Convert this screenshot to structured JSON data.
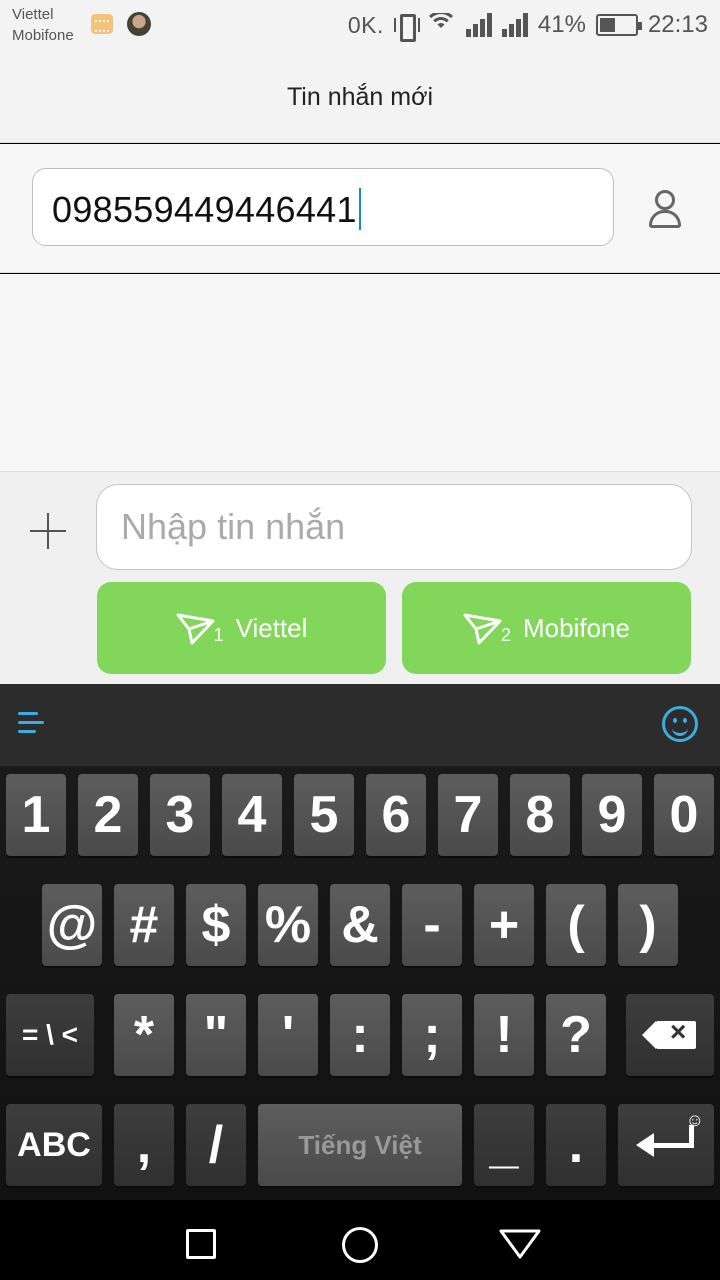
{
  "status_bar": {
    "carrier_1": "Viettel",
    "carrier_2": "Mobifone",
    "speed": "0K.",
    "battery": "41%",
    "time": "22:13"
  },
  "header": {
    "title": "Tin nhắn mới"
  },
  "recipient": {
    "value": "098559449446441"
  },
  "compose": {
    "placeholder": "Nhập tin nhắn",
    "send_sim1": {
      "label": "Viettel",
      "sim": "1"
    },
    "send_sim2": {
      "label": "Mobifone",
      "sim": "2"
    }
  },
  "keyboard": {
    "row1": [
      "1",
      "2",
      "3",
      "4",
      "5",
      "6",
      "7",
      "8",
      "9",
      "0"
    ],
    "row2": [
      "@",
      "#",
      "$",
      "%",
      "&",
      "-",
      "+",
      "(",
      ")"
    ],
    "row3": [
      "= \\ <",
      "*",
      "\"",
      "'",
      ":",
      ";",
      "!",
      "?"
    ],
    "row4": {
      "abc": "ABC",
      "comma": ",",
      "slash": "/",
      "space": "Tiếng Việt",
      "underscore": "_",
      "dot": "."
    }
  },
  "colors": {
    "send_green": "#82d65a",
    "accent_blue": "#3aaee0"
  }
}
